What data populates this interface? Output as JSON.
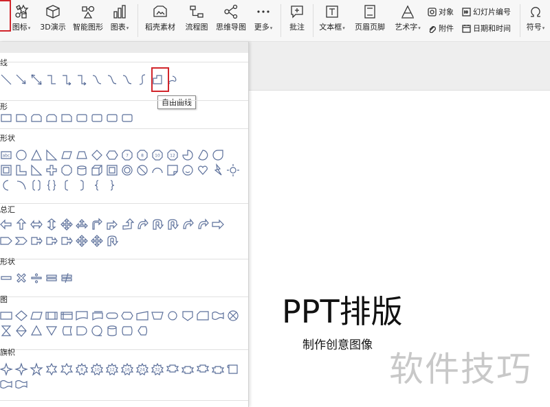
{
  "toolbar": {
    "items": [
      {
        "label": "图标",
        "icon": "icons-icon",
        "dropdown": true
      },
      {
        "label": "3D演示",
        "icon": "cube-icon",
        "dropdown": false
      },
      {
        "label": "智能图形",
        "icon": "smart-graphic-icon",
        "dropdown": false
      },
      {
        "label": "图表",
        "icon": "chart-icon",
        "dropdown": true
      },
      {
        "label": "稻壳素材",
        "icon": "docer-material-icon",
        "dropdown": false
      },
      {
        "label": "流程图",
        "icon": "flowchart-icon",
        "dropdown": false
      },
      {
        "label": "思维导图",
        "icon": "mindmap-icon",
        "dropdown": false
      },
      {
        "label": "更多",
        "icon": "more-icon",
        "dropdown": true
      },
      {
        "label": "批注",
        "icon": "comment-icon",
        "dropdown": false
      },
      {
        "label": "文本框",
        "icon": "textbox-icon",
        "dropdown": true
      },
      {
        "label": "页眉页脚",
        "icon": "header-footer-icon",
        "dropdown": false
      },
      {
        "label": "艺术字",
        "icon": "wordart-icon",
        "dropdown": true
      }
    ],
    "small_items": [
      {
        "label": "对象",
        "icon": "object-icon"
      },
      {
        "label": "附件",
        "icon": "attachment-icon"
      },
      {
        "label": "幻灯片编号",
        "icon": "slide-number-icon"
      },
      {
        "label": "日期和时间",
        "icon": "date-time-icon"
      }
    ],
    "symbol": {
      "label": "符号",
      "icon": "omega-icon",
      "dropdown": true
    }
  },
  "shape_panel": {
    "categories": [
      {
        "label": "线条",
        "visible_text": "线",
        "count": 12
      },
      {
        "label": "矩形",
        "visible_text": "形",
        "count": 9
      },
      {
        "label": "基本形状",
        "visible_text": "形状",
        "count": 42
      },
      {
        "label": "箭头总汇",
        "visible_text": "总汇",
        "count": 24
      },
      {
        "label": "公式形状",
        "visible_text": "形状",
        "count": 5
      },
      {
        "label": "流程图",
        "visible_text": "图",
        "count": 26
      },
      {
        "label": "星与旗帜",
        "visible_text": "旗帜",
        "count": 18
      }
    ],
    "highlighted_shape": "freeform-curve",
    "tooltip": "自由曲线"
  },
  "slide": {
    "title": "PPT排版",
    "subtitle": "制作创意图像"
  },
  "watermark": "软件技巧",
  "colors": {
    "highlight": "#d1242a",
    "shape_stroke": "#5b6f9a",
    "toolbar_bg": "#f7f7f7"
  }
}
